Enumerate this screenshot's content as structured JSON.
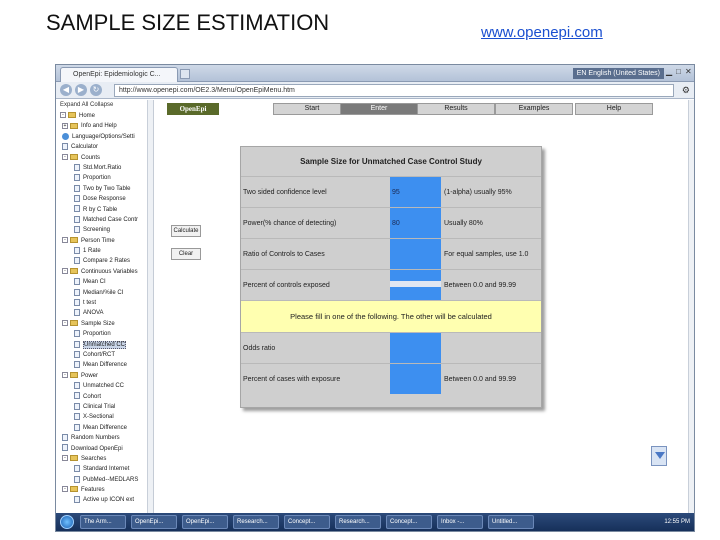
{
  "slide": {
    "title": "SAMPLE SIZE ESTIMATION",
    "link": "www.openepi.com"
  },
  "browser": {
    "tab_title": "OpenEpi: Epidemiologic C...",
    "language": "EN English (United States)",
    "url": "http://www.openepi.com/OE2.3/Menu/OpenEpiMenu.htm"
  },
  "sidebar": {
    "header": "Expand All  Collapse",
    "items": [
      {
        "label": "Home",
        "level": 0,
        "kind": "folder",
        "toggle": "-"
      },
      {
        "label": "Info and Help",
        "level": 1,
        "kind": "folder",
        "toggle": "+"
      },
      {
        "label": "Language/Options/Setti",
        "level": 1,
        "kind": "globe",
        "toggle": ""
      },
      {
        "label": "Calculator",
        "level": 1,
        "kind": "doc",
        "toggle": ""
      },
      {
        "label": "Counts",
        "level": 1,
        "kind": "folder",
        "toggle": "-"
      },
      {
        "label": "Std.Mort.Ratio",
        "level": 2,
        "kind": "doc",
        "toggle": ""
      },
      {
        "label": "Proportion",
        "level": 2,
        "kind": "doc",
        "toggle": ""
      },
      {
        "label": "Two by Two Table",
        "level": 2,
        "kind": "doc",
        "toggle": ""
      },
      {
        "label": "Dose Response",
        "level": 2,
        "kind": "doc",
        "toggle": ""
      },
      {
        "label": "R by C Table",
        "level": 2,
        "kind": "doc",
        "toggle": ""
      },
      {
        "label": "Matched Case Contr",
        "level": 2,
        "kind": "doc",
        "toggle": ""
      },
      {
        "label": "Screening",
        "level": 2,
        "kind": "doc",
        "toggle": ""
      },
      {
        "label": "Person Time",
        "level": 1,
        "kind": "folder",
        "toggle": "-"
      },
      {
        "label": "1 Rate",
        "level": 2,
        "kind": "doc",
        "toggle": ""
      },
      {
        "label": "Compare 2 Rates",
        "level": 2,
        "kind": "doc",
        "toggle": ""
      },
      {
        "label": "Continuous Variables",
        "level": 1,
        "kind": "folder",
        "toggle": "-"
      },
      {
        "label": "Mean CI",
        "level": 2,
        "kind": "doc",
        "toggle": ""
      },
      {
        "label": "Median/%ile CI",
        "level": 2,
        "kind": "doc",
        "toggle": ""
      },
      {
        "label": "t test",
        "level": 2,
        "kind": "doc",
        "toggle": ""
      },
      {
        "label": "ANOVA",
        "level": 2,
        "kind": "doc",
        "toggle": ""
      },
      {
        "label": "Sample Size",
        "level": 1,
        "kind": "folder",
        "toggle": "-"
      },
      {
        "label": "Proportion",
        "level": 2,
        "kind": "doc",
        "toggle": ""
      },
      {
        "label": "Unmatched CC",
        "level": 2,
        "kind": "doc",
        "toggle": "",
        "selected": true
      },
      {
        "label": "Cohort/RCT",
        "level": 2,
        "kind": "doc",
        "toggle": ""
      },
      {
        "label": "Mean Difference",
        "level": 2,
        "kind": "doc",
        "toggle": ""
      },
      {
        "label": "Power",
        "level": 1,
        "kind": "folder",
        "toggle": "-"
      },
      {
        "label": "Unmatched CC",
        "level": 2,
        "kind": "doc",
        "toggle": ""
      },
      {
        "label": "Cohort",
        "level": 2,
        "kind": "doc",
        "toggle": ""
      },
      {
        "label": "Clinical Trial",
        "level": 2,
        "kind": "doc",
        "toggle": ""
      },
      {
        "label": "X-Sectional",
        "level": 2,
        "kind": "doc",
        "toggle": ""
      },
      {
        "label": "Mean Difference",
        "level": 2,
        "kind": "doc",
        "toggle": ""
      },
      {
        "label": "Random Numbers",
        "level": 1,
        "kind": "doc",
        "toggle": ""
      },
      {
        "label": "Download OpenEpi",
        "level": 1,
        "kind": "doc",
        "toggle": ""
      },
      {
        "label": "Searches",
        "level": 1,
        "kind": "folder",
        "toggle": "-"
      },
      {
        "label": "Standard Internet",
        "level": 2,
        "kind": "doc",
        "toggle": ""
      },
      {
        "label": "PubMed--MEDLARS",
        "level": 2,
        "kind": "doc",
        "toggle": ""
      },
      {
        "label": "Features",
        "level": 1,
        "kind": "folder",
        "toggle": "-"
      },
      {
        "label": "Active up ICON ext",
        "level": 2,
        "kind": "doc",
        "toggle": ""
      }
    ]
  },
  "main": {
    "logo": "OpenEpi",
    "tabs": [
      {
        "label": "Start",
        "active": false
      },
      {
        "label": "Enter",
        "active": true
      },
      {
        "label": "Results",
        "active": false
      },
      {
        "label": "Examples",
        "active": false
      },
      {
        "label": "Help",
        "active": false
      }
    ],
    "calculate_label": "Calculate",
    "clear_label": "Clear"
  },
  "form": {
    "title": "Sample Size for Unmatched Case Control Study",
    "rows": [
      {
        "label": "Two sided confidence level",
        "value": "95",
        "note": "(1-alpha) usually 95%"
      },
      {
        "label": "Power(% chance of detecting)",
        "value": "80",
        "note": "Usually 80%"
      },
      {
        "label": "Ratio of Controls to Cases",
        "value": "",
        "note": "For equal samples, use 1.0"
      },
      {
        "label": "Percent of controls exposed",
        "value": "",
        "note": "Between 0.0 and 99.99"
      }
    ],
    "banner": "Please fill in one of the following. The other will be calculated",
    "rows2": [
      {
        "label": "Odds ratio",
        "value": "",
        "note": ""
      },
      {
        "label": "Percent of cases with exposure",
        "value": "",
        "note": "Between 0.0 and 99.99"
      }
    ]
  },
  "taskbar": {
    "items": [
      "The Arm...",
      "OpenEpi...",
      "OpenEpi...",
      "Research...",
      "Concept...",
      "Research...",
      "Concept...",
      "Inbox -...",
      "Untitled..."
    ],
    "clock": "12:55 PM"
  }
}
